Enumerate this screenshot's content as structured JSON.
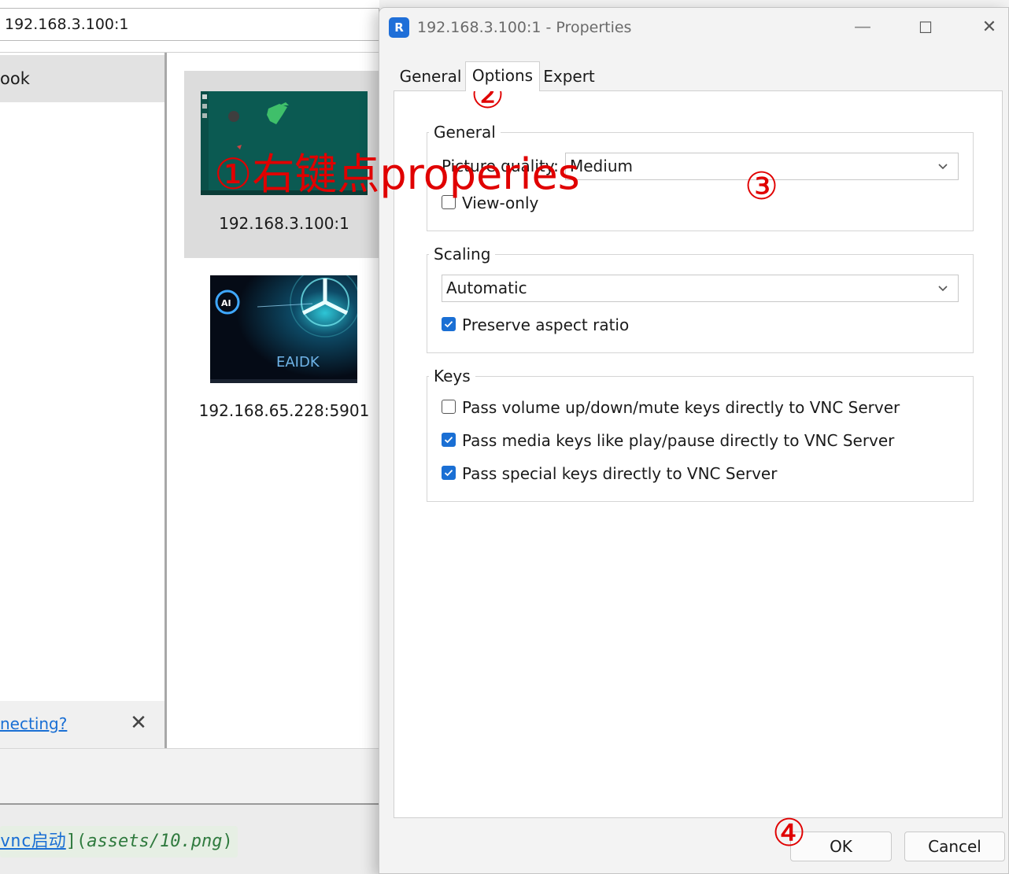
{
  "colors": {
    "accent": "#1a6fd4",
    "annotation_red": "#e00000",
    "checkbox_checked": "#1a6fd4"
  },
  "background_window": {
    "address_value": "192.168.3.100:1",
    "sidebar_item": "ook",
    "help_link": "necting?",
    "close_glyph": "✕",
    "connections": [
      {
        "label": "192.168.3.100:1",
        "selected": true
      },
      {
        "label": "192.168.65.228:5901",
        "selected": false,
        "thumbnail_text": "EAIDK"
      }
    ]
  },
  "markdown_snippet": {
    "link_text": "vnc启动",
    "bracket_close": "](",
    "path": "assets/10.png",
    "paren_close": ")"
  },
  "dialog": {
    "title": "192.168.3.100:1 - Properties",
    "app_icon": "realvnc-icon",
    "tabs": [
      {
        "label": "General",
        "active": false
      },
      {
        "label": "Options",
        "active": true
      },
      {
        "label": "Expert",
        "active": false
      }
    ],
    "groups": {
      "general": {
        "title": "General",
        "quality_label": "Picture quality:",
        "quality_value": "Medium",
        "view_only_label": "View-only",
        "view_only_checked": false
      },
      "scaling": {
        "title": "Scaling",
        "mode_value": "Automatic",
        "preserve_label": "Preserve aspect ratio",
        "preserve_checked": true
      },
      "keys": {
        "title": "Keys",
        "items": [
          {
            "label": "Pass volume up/down/mute keys directly to VNC Server",
            "checked": false
          },
          {
            "label": "Pass media keys like play/pause directly to VNC Server",
            "checked": true
          },
          {
            "label": "Pass special keys directly to VNC Server",
            "checked": true
          }
        ]
      }
    },
    "buttons": {
      "ok": "OK",
      "cancel": "Cancel"
    }
  },
  "annotations": {
    "step1": "①右键点properies",
    "step2": "②",
    "step3": "③",
    "step4": "④"
  }
}
